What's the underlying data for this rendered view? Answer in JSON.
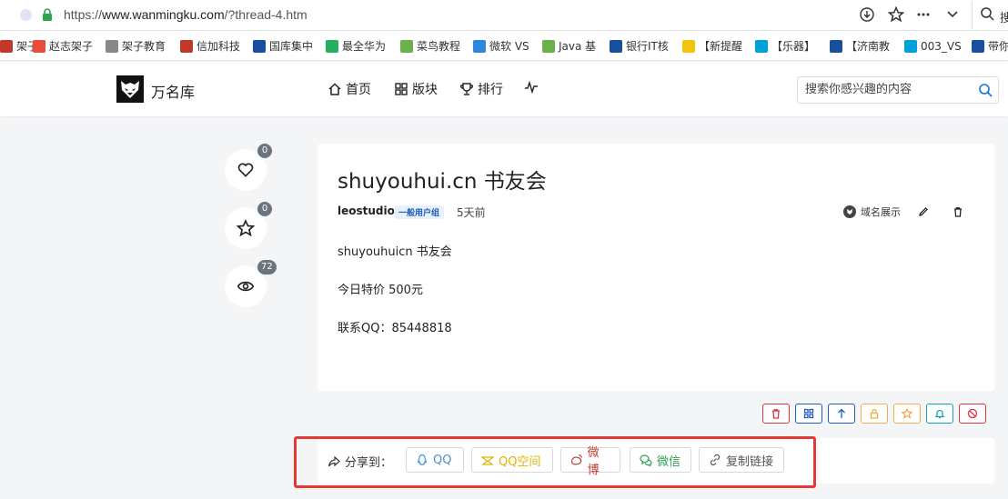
{
  "browser": {
    "url_scheme": "https://",
    "url_host": "www.wanmingku.com",
    "url_path": "/?thread-4.htm",
    "search_label": "搜"
  },
  "bookmarks": [
    {
      "label": "架子",
      "color": "#c0392b"
    },
    {
      "label": "赵志架子",
      "color": "#e74c3c"
    },
    {
      "label": "架子教育",
      "color": "#888888"
    },
    {
      "label": "信加科技",
      "color": "#c0392b"
    },
    {
      "label": "国库集中",
      "color": "#1a4fa0"
    },
    {
      "label": "最全华为",
      "color": "#27ae60"
    },
    {
      "label": "菜鸟教程",
      "color": "#6ab04c"
    },
    {
      "label": "微软 VS",
      "color": "#2e86de"
    },
    {
      "label": "Java 基",
      "color": "#6ab04c"
    },
    {
      "label": "银行IT核",
      "color": "#1a4fa0"
    },
    {
      "label": "【新提醒",
      "color": "#f1c40f"
    },
    {
      "label": "【乐器】",
      "color": "#00a1d6"
    },
    {
      "label": "【济南教",
      "color": "#1a4fa0"
    },
    {
      "label": "003_VS",
      "color": "#00a1d6"
    },
    {
      "label": "带你",
      "color": "#1a4fa0"
    }
  ],
  "site": {
    "name": "万名库",
    "nav": [
      {
        "label": "首页"
      },
      {
        "label": "版块"
      },
      {
        "label": "排行"
      }
    ],
    "search_placeholder": "搜索你感兴趣的内容"
  },
  "stats": {
    "likes": "0",
    "favorites": "0",
    "views": "72"
  },
  "post": {
    "title": "shuyouhui.cn 书友会",
    "author": "leostudio",
    "group": "一般用户组",
    "time": "5天前",
    "domain_show": "域名展示",
    "lines": [
      "shuyouhuicn 书友会",
      "今日特价 500元",
      "联系QQ：85448818"
    ]
  },
  "actions": {
    "colors": [
      "#dc3545",
      "#1e5bb8",
      "#1e5bb8",
      "#f0ad4e",
      "#f0ad4e",
      "#17a2b8",
      "#dc3545"
    ]
  },
  "share": {
    "label": "分享到：",
    "buttons": [
      {
        "label": "QQ",
        "color": "#4a90c8"
      },
      {
        "label": "QQ空间",
        "color": "#e0b400"
      },
      {
        "label": "微博",
        "color": "#c0392b"
      },
      {
        "label": "微信",
        "color": "#2e9e4f"
      },
      {
        "label": "复制链接",
        "color": "#555555"
      }
    ]
  }
}
